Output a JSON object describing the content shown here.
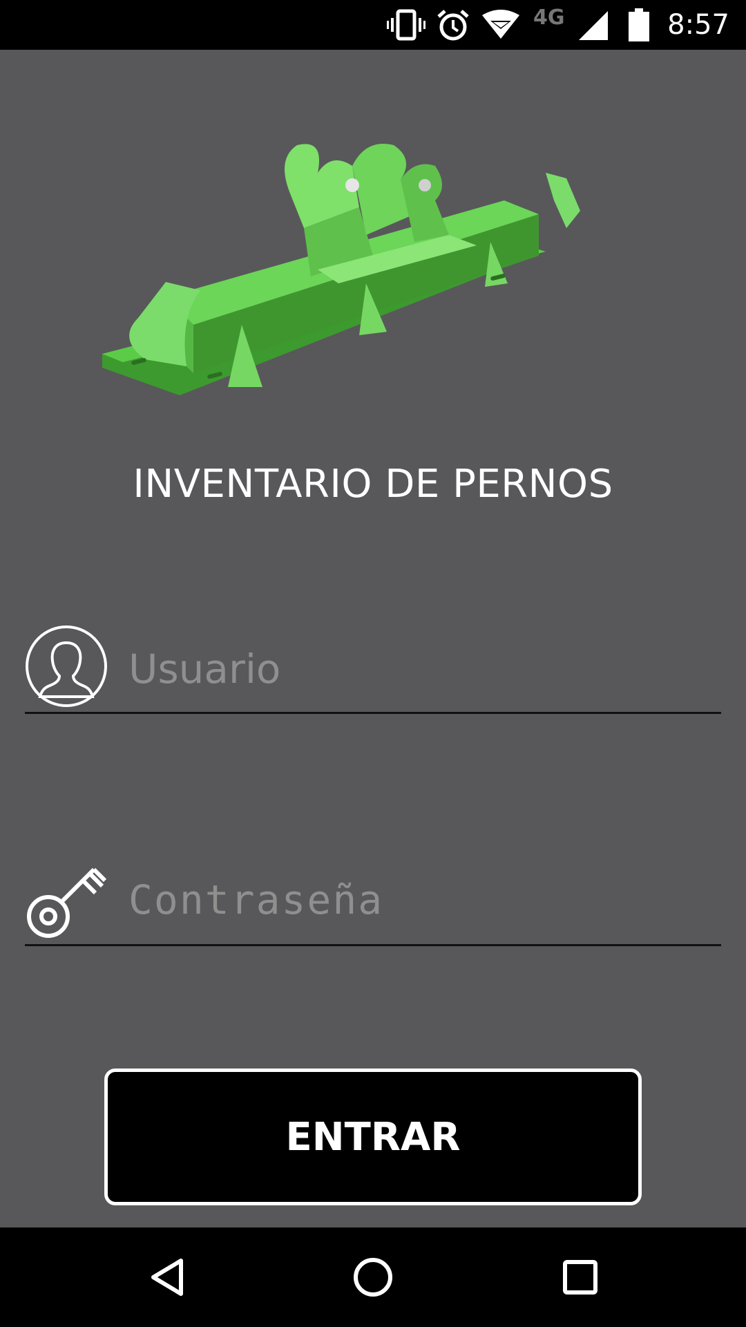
{
  "status_bar": {
    "time": "8:57",
    "network_label": "4G",
    "icons": [
      "vibrate-icon",
      "alarm-icon",
      "wifi-icon",
      "signal-icon",
      "battery-icon"
    ]
  },
  "app": {
    "title": "INVENTARIO DE PERNOS",
    "logo_icon": "green-bolt-support-icon"
  },
  "form": {
    "username": {
      "placeholder": "Usuario",
      "value": "",
      "icon": "user-icon"
    },
    "password": {
      "placeholder": "Contraseña",
      "value": "",
      "icon": "key-icon"
    },
    "submit_label": "ENTRAR"
  },
  "nav_bar": {
    "buttons": [
      "back-icon",
      "home-icon",
      "recents-icon"
    ]
  },
  "colors": {
    "background": "#58585a",
    "accent_green": "#4caf50",
    "button_bg": "#000000",
    "text": "#ffffff"
  }
}
